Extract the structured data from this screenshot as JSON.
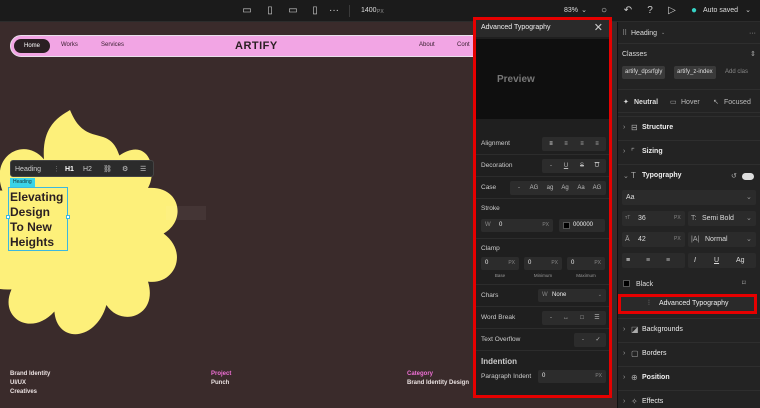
{
  "topbar": {
    "breakpoint_label": "1400",
    "breakpoint_unit": "PX",
    "zoom": "83%",
    "autosave": "Auto saved"
  },
  "site": {
    "nav": {
      "home": "Home",
      "works": "Works",
      "services": "Services",
      "about": "About",
      "contact": "Cont"
    },
    "logo": "ARTIFY",
    "hero_lines": [
      "Elevating",
      "Design",
      "To New",
      "Heights"
    ],
    "heading_tag": "Heading",
    "toolbar": {
      "label": "Heading",
      "h1": "H1",
      "h2": "H2"
    },
    "footer": {
      "col1": [
        "Brand Identity",
        "UI/UX",
        "Creatives"
      ],
      "project_title": "Project",
      "project_value": "Punch",
      "category_title": "Category",
      "category_value": "Brand Identity Design"
    },
    "colors": {
      "flower": "#fdf07a",
      "nav": "#f2a5e4",
      "canvas": "#3a2b2b"
    }
  },
  "advanced": {
    "title": "Advanced Typography",
    "preview": "Preview",
    "alignment": "Alignment",
    "decoration": "Decoration",
    "decoration_none": "-",
    "case": "Case",
    "case_options": [
      "-",
      "AG",
      "ag",
      "Ag",
      "Aa",
      "AG"
    ],
    "stroke": "Stroke",
    "stroke_w_label": "W",
    "stroke_w_value": "0",
    "stroke_w_unit": "PX",
    "stroke_color": "000000",
    "clamp": "Clamp",
    "clamp_values": [
      "0",
      "0",
      "0"
    ],
    "clamp_unit": "PX",
    "clamp_labels": [
      "Base",
      "Minimum",
      "Maximum"
    ],
    "chars": "Chars",
    "chars_prefix": "W",
    "chars_value": "None",
    "word_break": "Word Break",
    "word_break_none": "-",
    "text_overflow": "Text Overflow",
    "text_overflow_none": "-",
    "indention": "Indention",
    "paragraph_indent": "Paragraph Indent",
    "paragraph_indent_value": "0",
    "paragraph_indent_unit": "PX"
  },
  "sidebar": {
    "element": "Heading",
    "classes_label": "Classes",
    "classes": [
      "artify_dpsrfgly",
      "artify_z-index",
      "Add clas"
    ],
    "states": [
      "Neutral",
      "Hover",
      "Focused"
    ],
    "structure": "Structure",
    "sizing": "Sizing",
    "typography": "Typography",
    "font": "Aa",
    "font_size": "36",
    "font_size_unit": "PX",
    "font_weight": "Semi Bold",
    "line_height": "42",
    "line_height_unit": "PX",
    "letter_spacing": "Normal",
    "text_color": "Black",
    "adv_button": "Advanced Typography",
    "backgrounds": "Backgrounds",
    "borders": "Borders",
    "position": "Position",
    "effects": "Effects"
  }
}
